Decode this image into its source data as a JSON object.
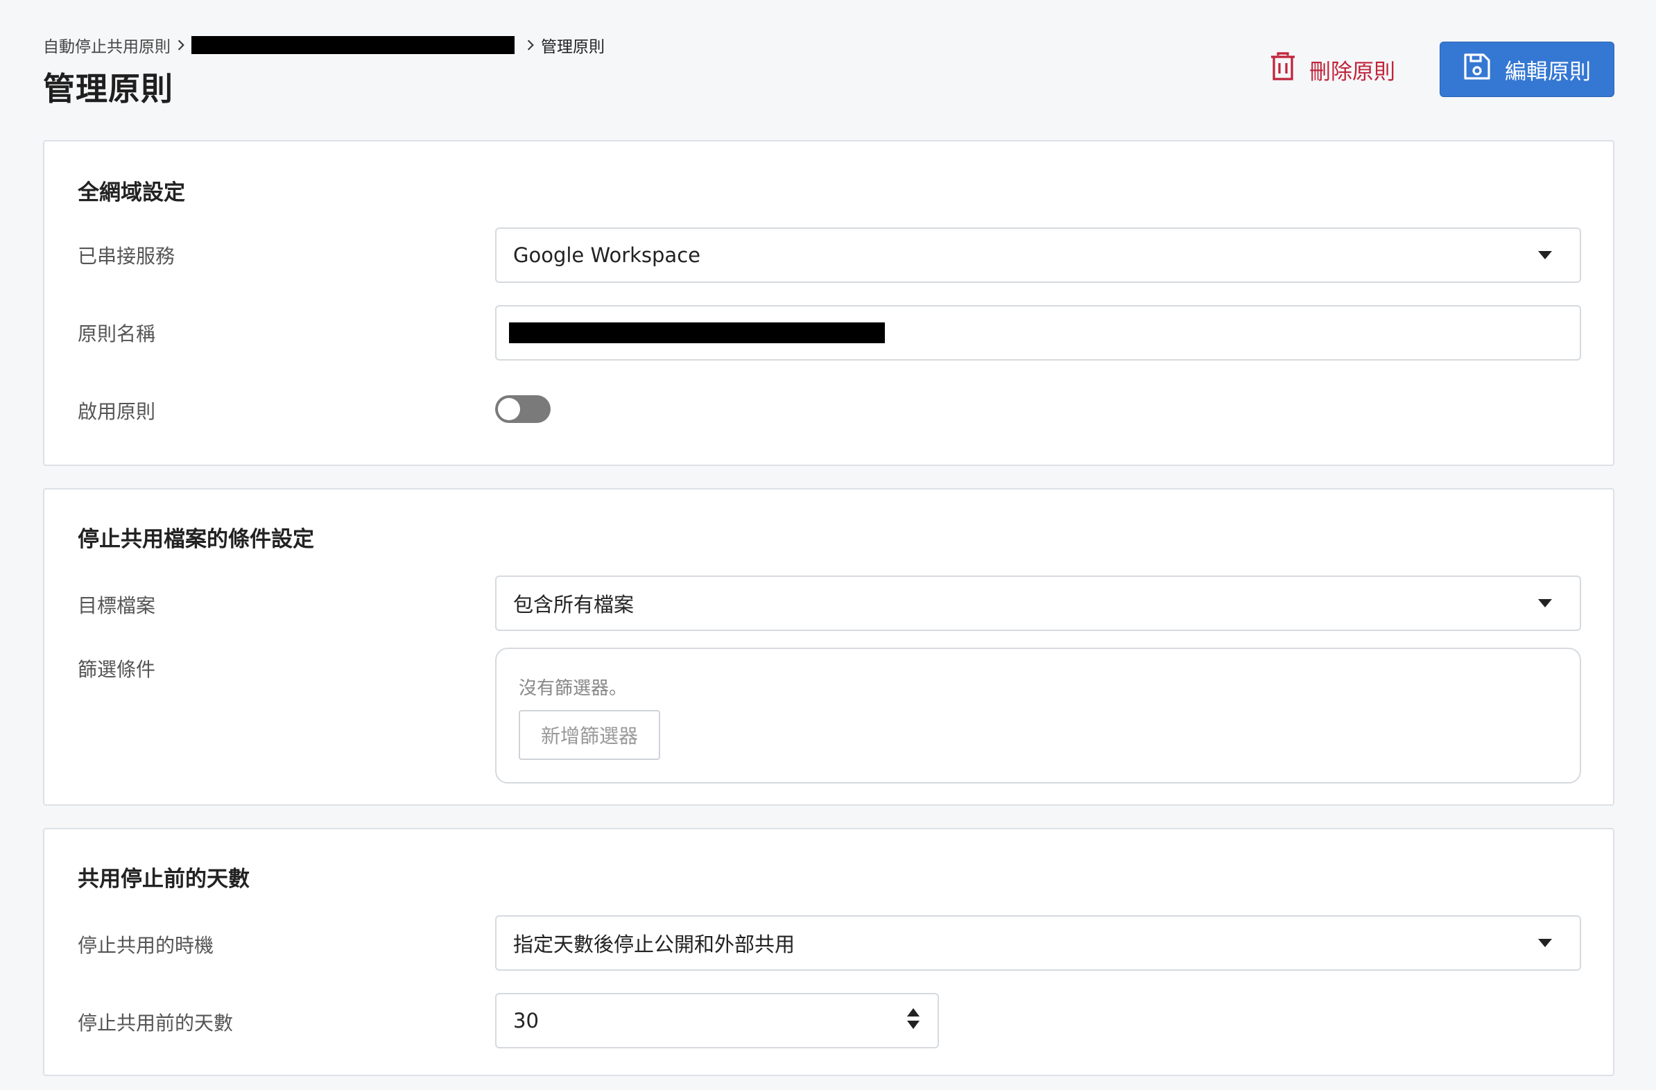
{
  "breadcrumb": {
    "root": "自動停止共用原則",
    "current": "管理原則"
  },
  "header": {
    "title": "管理原則",
    "delete_label": "刪除原則",
    "edit_label": "編輯原則"
  },
  "colors": {
    "primary": "#3578d4",
    "danger": "#c0233a",
    "background": "#f6f7f9"
  },
  "global_settings": {
    "title": "全網域設定",
    "service_label": "已串接服務",
    "service_value": "Google Workspace",
    "policy_name_label": "原則名稱",
    "enable_label": "啟用原則",
    "enabled": false
  },
  "conditions": {
    "title": "停止共用檔案的條件設定",
    "target_label": "目標檔案",
    "target_value": "包含所有檔案",
    "filter_label": "篩選條件",
    "filter_empty_text": "沒有篩選器。",
    "add_filter_label": "新增篩選器"
  },
  "days": {
    "title": "共用停止前的天數",
    "timing_label": "停止共用的時機",
    "timing_value": "指定天數後停止公開和外部共用",
    "days_label": "停止共用前的天數",
    "days_value": "30"
  }
}
